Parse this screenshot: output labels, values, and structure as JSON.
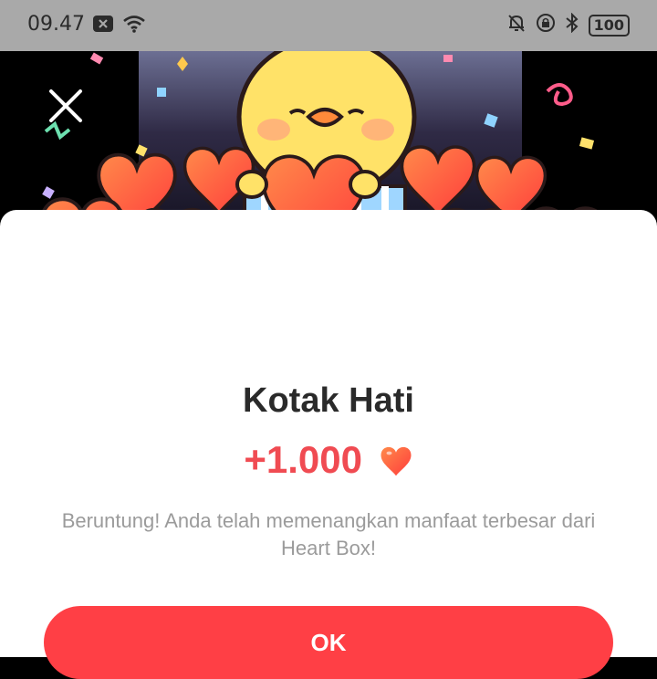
{
  "status_bar": {
    "time": "09.47",
    "battery": "100",
    "icons": [
      "notification-x-icon",
      "wifi-icon",
      "mute-bell-icon",
      "lock-rotation-icon",
      "bluetooth-icon",
      "battery-icon"
    ]
  },
  "dialog": {
    "title": "Kotak Hati",
    "amount": "+1.000",
    "amount_icon": "heart-icon",
    "description": "Beruntung! Anda telah memenangkan manfaat terbesar dari Heart Box!",
    "ok_label": "OK",
    "close_icon": "close-icon"
  },
  "colors": {
    "accent": "#ff3f45",
    "amount": "#f04b52",
    "heart": "#ff5a46",
    "status_bar": "#a9a9a9"
  }
}
